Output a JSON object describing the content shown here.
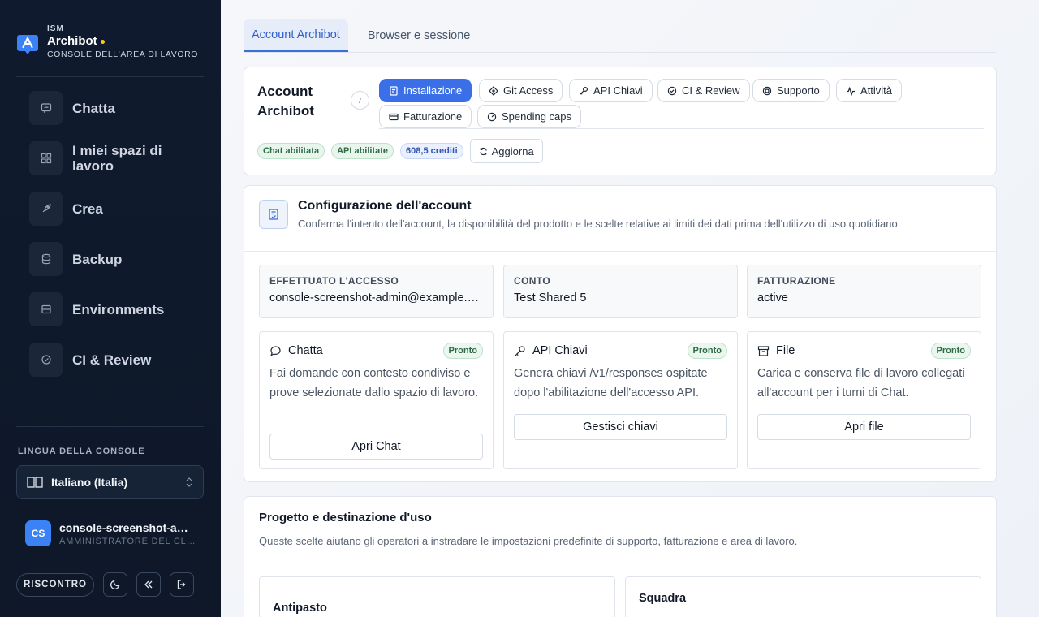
{
  "sidebar": {
    "brand": {
      "small": "ISM",
      "name": "Archibot",
      "subtitle": "CONSOLE DELL'AREA DI LAVORO"
    },
    "nav": [
      {
        "label": "Chatta",
        "icon": "chat-icon"
      },
      {
        "label": "I miei spazi di lavoro",
        "icon": "grid-icon"
      },
      {
        "label": "Crea",
        "icon": "rocket-icon"
      },
      {
        "label": "Backup",
        "icon": "database-icon"
      },
      {
        "label": "Environments",
        "icon": "server-icon"
      },
      {
        "label": "CI & Review",
        "icon": "check-circle-icon"
      }
    ],
    "language": {
      "title": "LINGUA DELLA CONSOLE",
      "selected": "Italiano (Italia)"
    },
    "user": {
      "initials": "CS",
      "name": "console-screenshot-admin@example.com",
      "role": "AMMINISTRATORE DEL CLIENTE"
    },
    "feedback_label": "RISCONTRO"
  },
  "tabs": [
    {
      "label": "Account Archibot",
      "active": true
    },
    {
      "label": "Browser e sessione",
      "active": false
    }
  ],
  "account": {
    "title": "Account Archibot",
    "info_glyph": "i",
    "pills": [
      {
        "label": "Installazione",
        "icon": "doc-icon",
        "active": true
      },
      {
        "label": "Git Access",
        "icon": "git-icon",
        "active": false
      },
      {
        "label": "API Chiavi",
        "icon": "key-icon",
        "active": false
      },
      {
        "label": "CI & Review",
        "icon": "check-circle-icon",
        "active": false
      },
      {
        "label": "Supporto",
        "icon": "lifebuoy-icon",
        "active": false
      },
      {
        "label": "Attività",
        "icon": "activity-icon",
        "active": false
      },
      {
        "label": "Fatturazione",
        "icon": "card-icon",
        "active": false
      },
      {
        "label": "Spending caps",
        "icon": "gauge-icon",
        "active": false
      }
    ],
    "badges": [
      {
        "label": "Chat abilitata",
        "tone": "green"
      },
      {
        "label": "API abilitate",
        "tone": "green"
      },
      {
        "label": "608,5 crediti",
        "tone": "blue"
      }
    ],
    "refresh_label": "Aggiorna"
  },
  "config": {
    "title": "Configurazione dell'account",
    "subtitle": "Conferma l'intento dell'account, la disponibilità del prodotto e le scelte relative ai limiti dei dati prima dell'utilizzo di uso quotidiano.",
    "info": [
      {
        "label": "EFFETTUATO L'ACCESSO",
        "value": "console-screenshot-admin@example.com"
      },
      {
        "label": "CONTO",
        "value": "Test Shared 5"
      },
      {
        "label": "FATTURAZIONE",
        "value": "active"
      }
    ],
    "features": [
      {
        "title": "Chatta",
        "icon": "chat-bubble-icon",
        "status": "Pronto",
        "desc": "Fai domande con contesto condiviso e prove selezionate dallo spazio di lavoro.",
        "button": "Apri Chat"
      },
      {
        "title": "API Chiavi",
        "icon": "key-icon",
        "status": "Pronto",
        "desc": "Genera chiavi /v1/responses ospitate dopo l'abilitazione dell'accesso API.",
        "button": "Gestisci chiavi"
      },
      {
        "title": "File",
        "icon": "archive-icon",
        "status": "Pronto",
        "desc": "Carica e conserva file di lavoro collegati all'account per i turni di Chat.",
        "button": "Apri file"
      }
    ]
  },
  "project": {
    "title": "Progetto e destinazione d'uso",
    "subtitle": "Queste scelte aiutano gli operatori a instradare le impostazioni predefinite di supporto, fatturazione e area di lavoro.",
    "options": [
      "Antipasto",
      "Squadra"
    ]
  },
  "colors": {
    "accent": "#3b6fe8",
    "sidebar": "#0f1a2e",
    "brand_dot": "#facc15",
    "ready": "#2f6b45"
  }
}
